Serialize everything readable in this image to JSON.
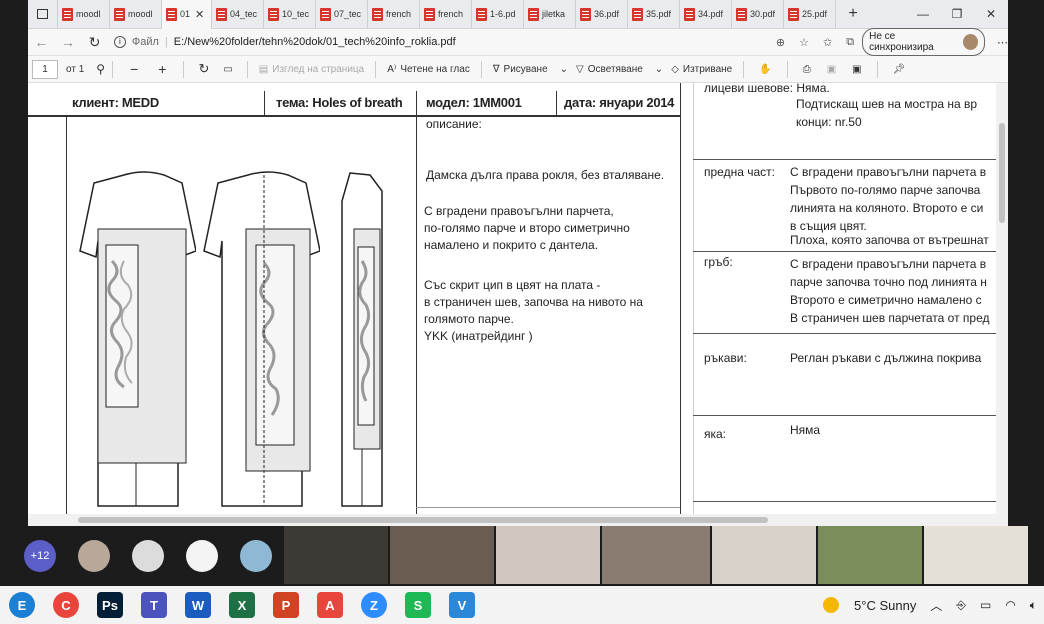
{
  "browser": {
    "tabs": [
      {
        "label": "moodl",
        "kind": "pdf"
      },
      {
        "label": "moodl",
        "kind": "pdf"
      },
      {
        "label": "01",
        "kind": "pdf",
        "active": true
      },
      {
        "label": "04_tec",
        "kind": "pdf"
      },
      {
        "label": "10_tec",
        "kind": "pdf"
      },
      {
        "label": "07_tec",
        "kind": "pdf"
      },
      {
        "label": "french",
        "kind": "pdf"
      },
      {
        "label": "french",
        "kind": "pdf"
      },
      {
        "label": "1-6.pd",
        "kind": "pdf"
      },
      {
        "label": "jiletka",
        "kind": "pdf"
      },
      {
        "label": "36.pdf",
        "kind": "pdf"
      },
      {
        "label": "35.pdf",
        "kind": "pdf"
      },
      {
        "label": "34.pdf",
        "kind": "pdf"
      },
      {
        "label": "30.pdf",
        "kind": "pdf"
      },
      {
        "label": "25.pdf",
        "kind": "pdf"
      }
    ],
    "new_tab": "+",
    "address": {
      "scheme_label": "Файл",
      "url": "E:/New%20folder/tehn%20dok/01_tech%20info_roklia.pdf"
    },
    "sync_label": "Не се синхронизира"
  },
  "pdf_toolbar": {
    "page_value": "1",
    "page_of": "от 1",
    "view_label": "Изглед на страница",
    "read_label": "Четене на глас",
    "draw_label": "Рисуване",
    "highlight_label": "Осветяване",
    "erase_label": "Изтриване"
  },
  "document": {
    "client": "клиент:   MEDD",
    "theme": "тема: Holes of breath",
    "model": "модел: 1MM001",
    "date": "дата: януари 2014",
    "description_label": "описание:",
    "desc1": "Дамска дълга права рокля, без вталяване.",
    "desc2": [
      "С вградени правоъгълни парчета,",
      "по-голямо парче и второ симетрично",
      "намалено и покрито с дантела."
    ],
    "desc3": [
      "Със скрит цип в цвят на плата -",
      "в страничен шев, започва на нивото на",
      "голямото парче.",
      "YKK (инатрейдинг )"
    ],
    "right": {
      "top_label": "лицеви шевове:",
      "top_value": "Няма.",
      "stitch": "Подтискащ  шев  на мостра на вр",
      "thread": "конци: nr.50",
      "front_label": "предна част:",
      "front_lines": [
        "С вградени правоъгълни парчета в",
        "Първото по-голямо парче започва",
        "линията на коляното. Второто е си",
        "в същия цвят."
      ],
      "front_extra": "Плоха, която започва от вътрешнат",
      "back_label": "гръб:",
      "back_lines": [
        "С вградени правоъгълни парчета в",
        "парче започва точно под линията н",
        "Второто е симетрично намалено с",
        "В страничен шев парчетата от пред"
      ],
      "sleeves_label": "ръкави:",
      "sleeves_value": "Реглан ръкави с дължина покрива",
      "collar_label": "яка:",
      "collar_value": "Няма"
    }
  },
  "call": {
    "more_count": "+12",
    "tiles": 7
  },
  "taskbar": {
    "apps": [
      {
        "name": "Edge",
        "color": "#1b7fd4"
      },
      {
        "name": "Chrome",
        "color": "#e8453c"
      },
      {
        "name": "Ps",
        "color": "#001e36"
      },
      {
        "name": "T",
        "color": "#4b53bc"
      },
      {
        "name": "W",
        "color": "#1a5dbf"
      },
      {
        "name": "X",
        "color": "#1e7145"
      },
      {
        "name": "P",
        "color": "#d04423"
      },
      {
        "name": "A",
        "color": "#e8453c"
      },
      {
        "name": "Zoom",
        "color": "#2d8cff"
      },
      {
        "name": "S",
        "color": "#1db954"
      },
      {
        "name": "V",
        "color": "#2b88d8"
      }
    ],
    "weather": "5°C  Sunny"
  },
  "colors": {
    "pdf": "#d9362b",
    "accent": "#0078d4"
  }
}
